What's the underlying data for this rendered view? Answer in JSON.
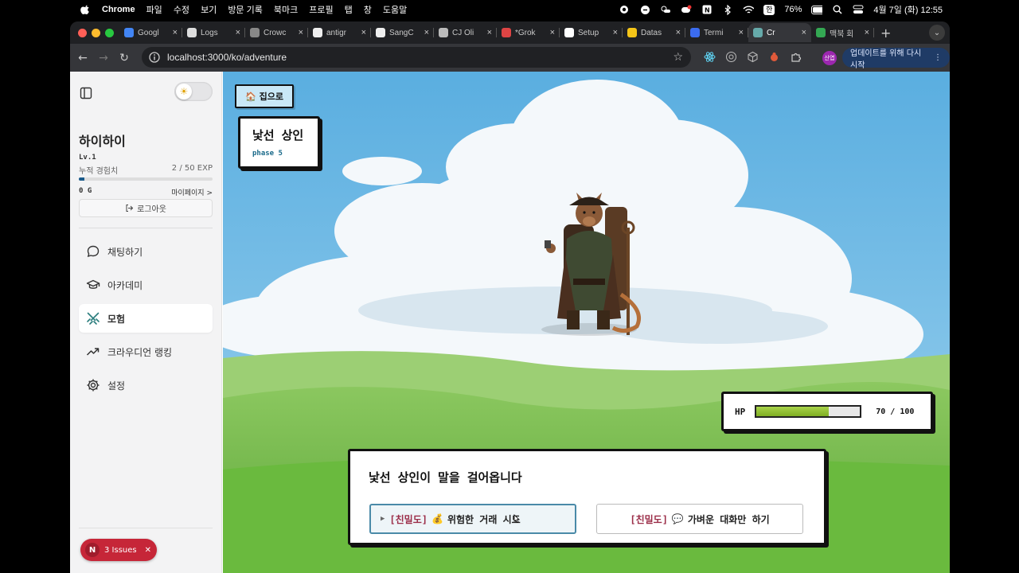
{
  "menubar": {
    "items": [
      "Chrome",
      "파일",
      "수정",
      "보기",
      "방문 기록",
      "북마크",
      "프로필",
      "탭",
      "창",
      "도움말"
    ],
    "battery": "76%",
    "datetime": "4월 7일 (화) 12:55",
    "input_method": "한"
  },
  "browser": {
    "tabs": [
      {
        "title": "Googl",
        "color": "#4285f4"
      },
      {
        "title": "Logs",
        "color": "#dddddd"
      },
      {
        "title": "Crowc",
        "color": "#888888"
      },
      {
        "title": "antigr",
        "color": "#eeeeee"
      },
      {
        "title": "SangC",
        "color": "#eeeeee"
      },
      {
        "title": "CJ Oli",
        "color": "#bbbbbb"
      },
      {
        "title": "*Grok",
        "color": "#d44"
      },
      {
        "title": "Setup",
        "color": "#ffffff"
      },
      {
        "title": "Datas",
        "color": "#f5c518"
      },
      {
        "title": "Termi",
        "color": "#3b6cf0"
      },
      {
        "title": "Cr",
        "color": "#6aa"
      },
      {
        "title": "맥북 회",
        "color": "#34a853"
      }
    ],
    "active_tab_index": 10,
    "url": "localhost:3000/ko/adventure",
    "profile_label": "산엽",
    "update_button": "업데이트를 위해 다시 시작"
  },
  "sidebar": {
    "username": "하이하이",
    "level": "Lv.1",
    "exp_label": "누적 경험치",
    "exp_value": "2 / 50 EXP",
    "exp_fraction": 0.04,
    "gold": "0 G",
    "mypage_link": "마이페이지 >",
    "logout": "로그아웃",
    "nav": [
      {
        "label": "채팅하기",
        "icon": "chat-bubble-icon"
      },
      {
        "label": "아카데미",
        "icon": "graduation-cap-icon"
      },
      {
        "label": "모험",
        "icon": "crossed-swords-icon",
        "active": true
      },
      {
        "label": "크라우디언 랭킹",
        "icon": "trending-up-icon"
      },
      {
        "label": "설정",
        "icon": "gear-icon"
      }
    ],
    "issues_badge": "3 Issues",
    "issues_logo": "N"
  },
  "game": {
    "home_button": "집으로",
    "npc_name": "낯선 상인",
    "phase": "phase 5",
    "hp_label": "HP",
    "hp_current": 70,
    "hp_max": 100,
    "hp_text": "70 / 100",
    "dialog_message": "낯선 상인이 말을 걸어옵니다",
    "choices": [
      {
        "tag": "[친밀도]",
        "emoji": "💰",
        "text": "위험한 거래 시도"
      },
      {
        "tag": "[친밀도]",
        "emoji": "💬",
        "text": "가벼운 대화만 하기"
      }
    ],
    "colors": {
      "sky": "#5eb3e4",
      "grass": "#6fba4a",
      "hp_fill": "#8dc236",
      "tag": "#9b2d48"
    }
  }
}
